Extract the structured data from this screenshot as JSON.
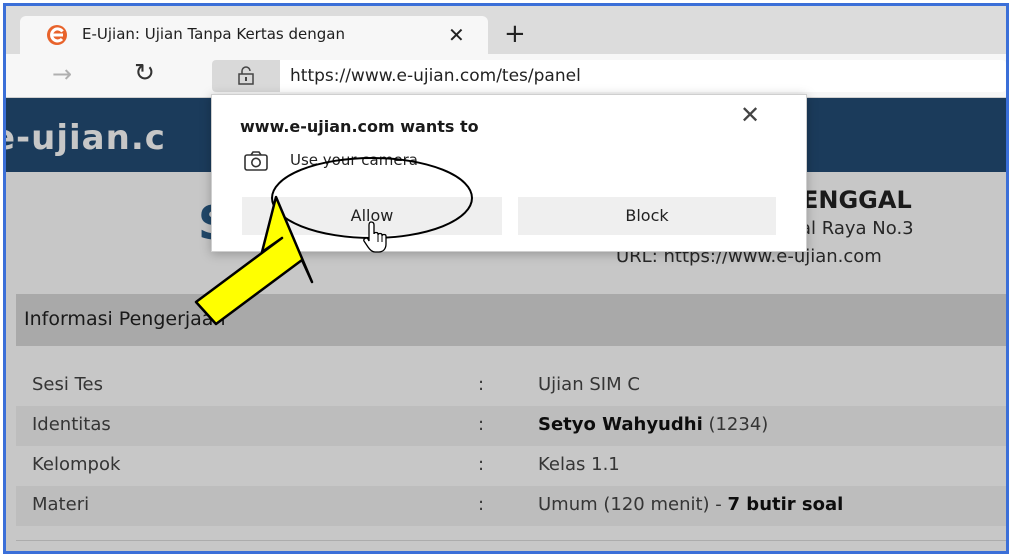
{
  "tab": {
    "title": "E-Ujian: Ujian Tanpa Kertas dengan",
    "close": "✕",
    "new_tab": "+"
  },
  "toolbar": {
    "forward": "→",
    "reload": "↻",
    "url": "https://www.e-ujian.com/tes/panel"
  },
  "page": {
    "brand": "e-ujian.c",
    "org_name": "ENGGAL",
    "org_address": "al Raya No.3",
    "org_url": "URL: https://www.e-ujian.com",
    "info_header": "Informasi Pengerjaan",
    "rows": [
      {
        "label": "Sesi Tes",
        "colon": ":",
        "value": "Ujian SIM C"
      },
      {
        "label": "Identitas",
        "colon": ":",
        "value_bold": "Setyo Wahyudhi",
        "value_rest": " (1234)"
      },
      {
        "label": "Kelompok",
        "colon": ":",
        "value": "Kelas 1.1"
      },
      {
        "label": "Materi",
        "colon": ":",
        "value": "Umum (120 menit) - ",
        "value_bold": "7 butir soal"
      }
    ]
  },
  "popup": {
    "title": "www.e-ujian.com wants to",
    "close": "✕",
    "permission": "Use your camera",
    "allow_label": "Allow",
    "block_label": "Block"
  },
  "colors": {
    "frame": "#3b6fd8",
    "brand_bar": "#234c75",
    "arrow_fill": "#ffff00",
    "logo_orange": "#e8632b"
  },
  "icons": {
    "tab_logo": "edge-e-logo-icon",
    "lock": "lock-icon",
    "camera": "camera-icon",
    "cursor": "hand-pointer-icon",
    "annotation_arrow": "yellow-arrow-icon"
  }
}
